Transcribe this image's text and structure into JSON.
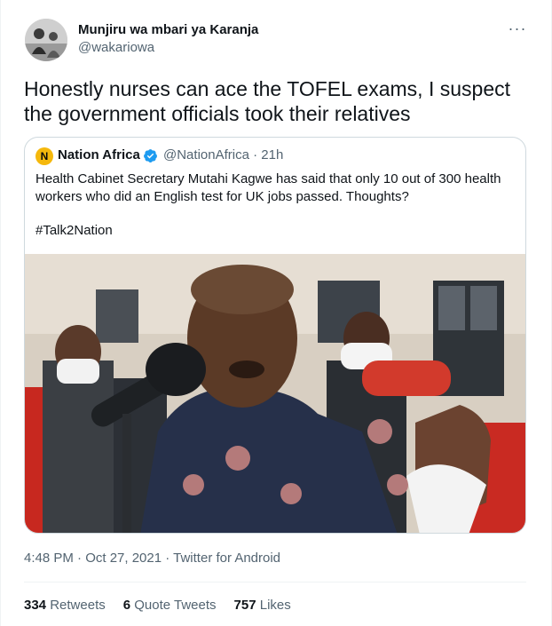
{
  "author": {
    "name": "Munjiru wa mbari ya Karanja",
    "handle": "@wakariowa",
    "more_label": "···"
  },
  "tweet": {
    "text": "Honestly nurses can ace the TOFEL exams, I suspect the government officials took their relatives"
  },
  "quoted_tweet": {
    "logo_letter": "N",
    "name": "Nation Africa",
    "verified_icon": "verified-badge-icon",
    "handle_time": "@NationAfrica · 21h",
    "text": "Health Cabinet Secretary Mutahi Kagwe has said that only 10 out of 300 health workers who did an English test for UK jobs passed. Thoughts?",
    "hashtag": "#Talk2Nation",
    "photo_icon": "press-conference-photo"
  },
  "meta": {
    "timestamp": "4:48 PM · Oct 27, 2021 · Twitter for Android"
  },
  "stats": {
    "retweets_count": "334",
    "retweets_label": "Retweets",
    "quotes_count": "6",
    "quotes_label": "Quote Tweets",
    "likes_count": "757",
    "likes_label": "Likes"
  },
  "colors": {
    "text_primary": "#0f1419",
    "text_secondary": "#536471",
    "border": "#cfd9de",
    "verified": "#1d9bf0",
    "nation_logo": "#f5b80c"
  }
}
